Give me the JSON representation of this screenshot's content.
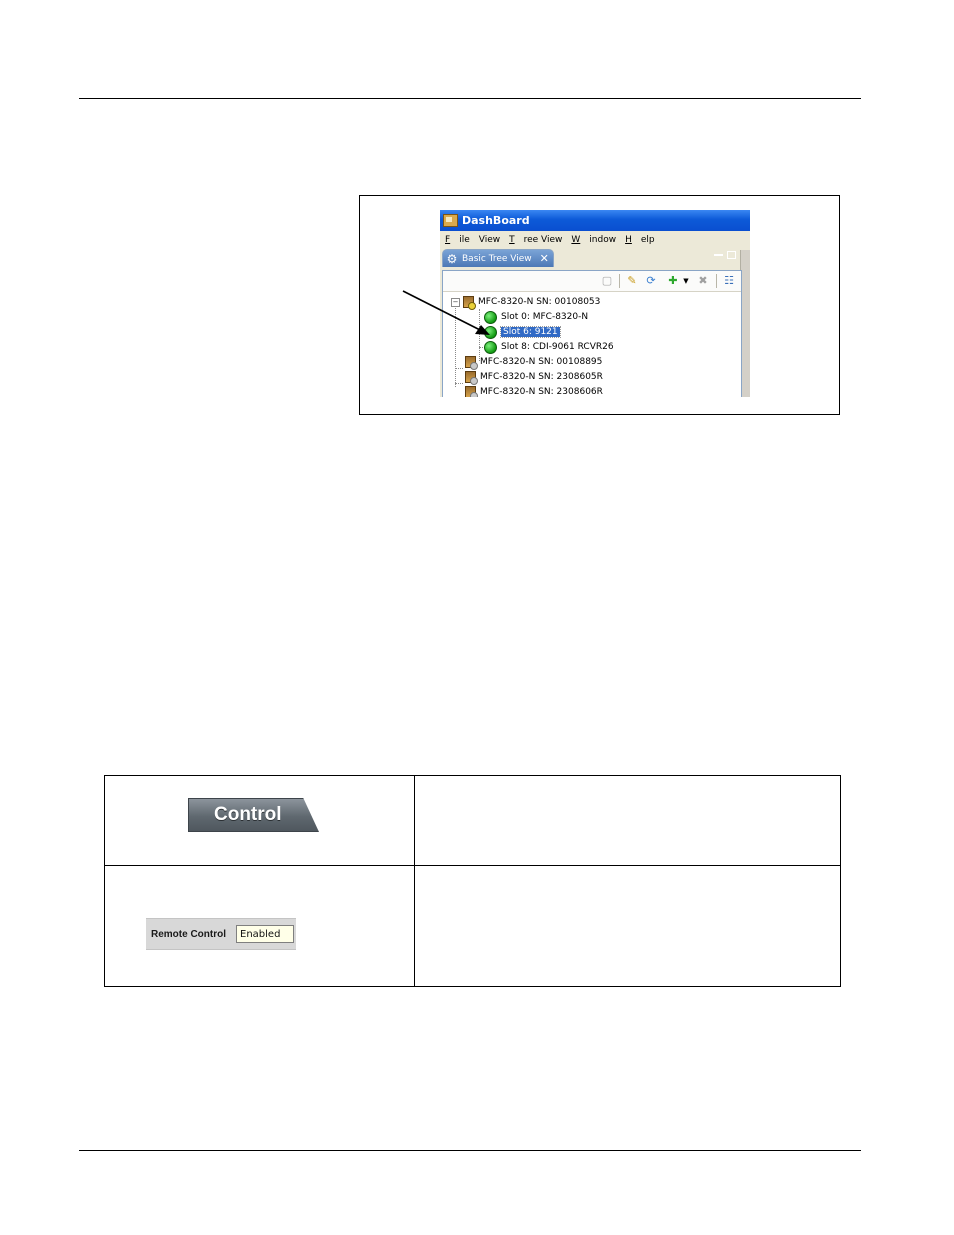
{
  "dashboard": {
    "title": "DashBoard",
    "menu": [
      "File",
      "View",
      "Tree View",
      "Window",
      "Help"
    ],
    "tab_label": "Basic Tree View",
    "tab_close": "✕",
    "tree": {
      "frame_1": "MFC-8320-N SN: 00108053",
      "slot_0": "Slot 0: MFC-8320-N",
      "slot_6": "Slot 6: 9121",
      "slot_8": "Slot 8: CDI-9061 RCVR26",
      "frame_2": "MFC-8320-N SN: 00108895",
      "frame_3": "MFC-8320-N SN: 2308605R",
      "frame_4": "MFC-8320-N SN: 2308606R"
    },
    "selected_node": "slot_6"
  },
  "table": {
    "control_tab_label": "Control",
    "remote_control_label": "Remote Control",
    "remote_control_value": "Enabled"
  },
  "colors": {
    "title_bar": "#0d5ad8",
    "selection": "#316ac5",
    "status_ok": "#119a11"
  }
}
